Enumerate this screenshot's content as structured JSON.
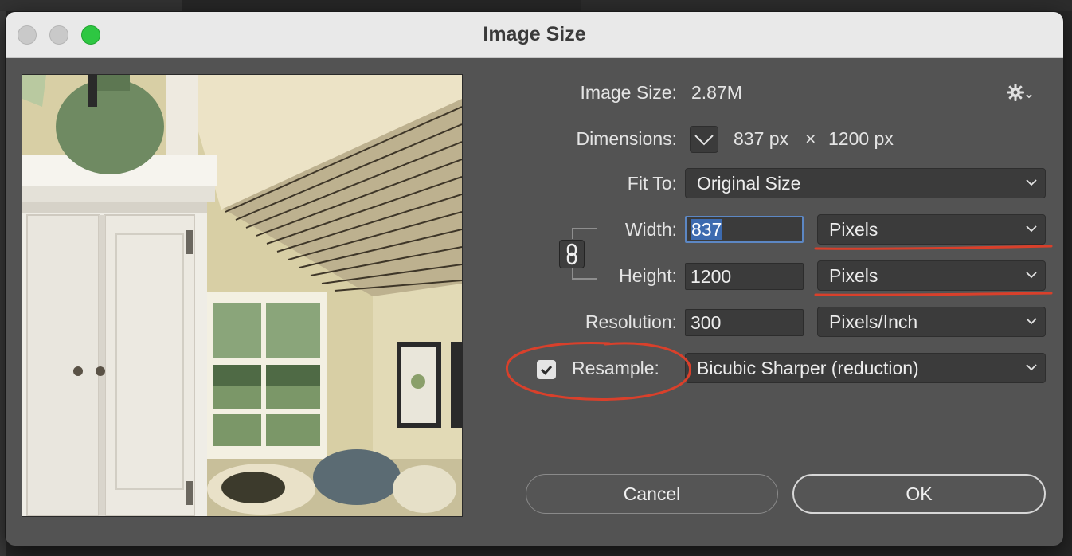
{
  "window": {
    "title": "Image Size"
  },
  "image_size": {
    "label": "Image Size:",
    "value": "2.87M"
  },
  "dimensions": {
    "label": "Dimensions:",
    "width_value": "837 px",
    "times": "×",
    "height_value": "1200 px"
  },
  "fit_to": {
    "label": "Fit To:",
    "value": "Original Size"
  },
  "width": {
    "label": "Width:",
    "value": "837",
    "unit": "Pixels"
  },
  "height": {
    "label": "Height:",
    "value": "1200",
    "unit": "Pixels"
  },
  "resolution": {
    "label": "Resolution:",
    "value": "300",
    "unit": "Pixels/Inch"
  },
  "resample": {
    "label": "Resample:",
    "checked": true,
    "method": "Bicubic Sharper (reduction)"
  },
  "buttons": {
    "cancel": "Cancel",
    "ok": "OK"
  },
  "icons": {
    "settings": "gear-icon",
    "constrain": "link-icon",
    "dimensions_toggle": "chevron-down-icon"
  },
  "colors": {
    "dialog_bg": "#535353",
    "field_bg": "#3b3b3b",
    "focus_ring": "#5c87c4",
    "annotation": "#d9402b",
    "zoom_light": "#2ec742"
  }
}
